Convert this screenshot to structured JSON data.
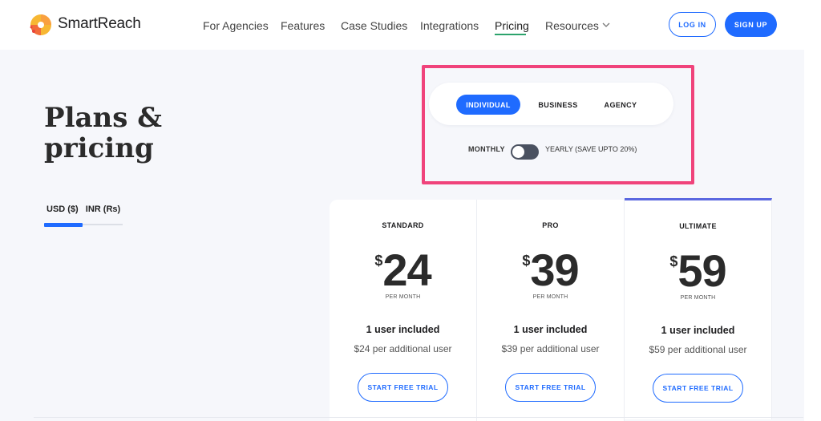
{
  "nav": {
    "brand": "SmartReach",
    "logo_icon": "smartreach-logo-icon",
    "items": [
      {
        "label": "For Agencies"
      },
      {
        "label": "Features"
      },
      {
        "label": "Case Studies"
      },
      {
        "label": "Integrations"
      },
      {
        "label": "Pricing",
        "active": true
      },
      {
        "label": "Resources",
        "icon": "chevron-down-icon"
      }
    ],
    "login_label": "LOG IN",
    "signup_label": "SIGN UP"
  },
  "hero": {
    "title_line1": "Plans &",
    "title_line2": "pricing"
  },
  "currency": {
    "options": [
      "USD ($)",
      "INR (Rs)"
    ],
    "selected": "USD ($)"
  },
  "plan_type": {
    "tabs": [
      "INDIVIDUAL",
      "BUSINESS",
      "AGENCY"
    ],
    "selected": "INDIVIDUAL"
  },
  "billing": {
    "monthly_label": "MONTHLY",
    "yearly_label": "YEARLY (SAVE UPTO 20%)",
    "yearly_enabled": false
  },
  "plans": [
    {
      "name": "STANDARD",
      "currency_symbol": "$",
      "price": "24",
      "period": "PER MONTH",
      "users": "1 user included",
      "additional": "$24 per additional user",
      "cta": "START FREE TRIAL"
    },
    {
      "name": "PRO",
      "currency_symbol": "$",
      "price": "39",
      "period": "PER MONTH",
      "users": "1 user included",
      "additional": "$39 per additional user",
      "cta": "START FREE TRIAL"
    },
    {
      "name": "ULTIMATE",
      "currency_symbol": "$",
      "price": "59",
      "period": "PER MONTH",
      "users": "1 user included",
      "additional": "$59 per additional user",
      "cta": "START FREE TRIAL"
    }
  ],
  "colors": {
    "primary": "#1f6bff",
    "highlight": "#f0437b",
    "nav_active_underline": "#2ca36c",
    "ultimate_accent": "#5b68e0",
    "background": "#f6f7fb"
  }
}
